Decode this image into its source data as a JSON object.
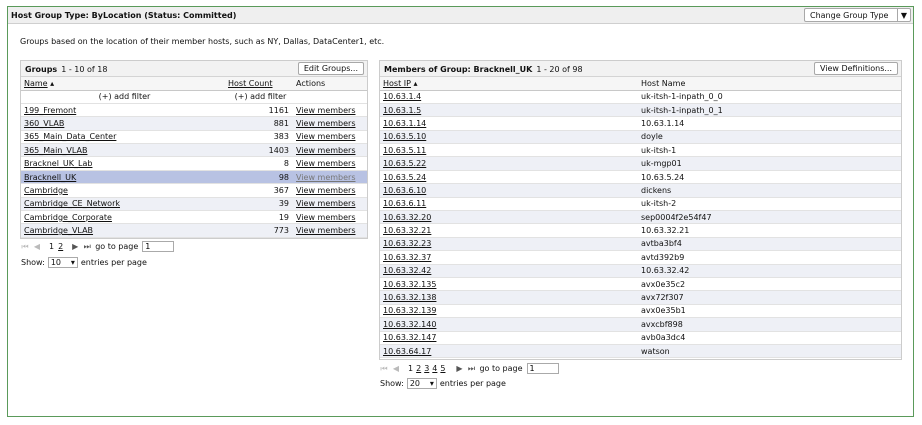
{
  "header": {
    "title": "Host Group Type: ByLocation (Status: Committed)",
    "change_button": "Change Group Type",
    "change_icon": "chevron-down-icon"
  },
  "description": "Groups based on the location of their member hosts, such as NY, Dallas, DataCenter1, etc.",
  "groups": {
    "title": "Groups",
    "range": "1 - 10 of 18",
    "edit_button": "Edit Groups...",
    "columns": {
      "name": "Name",
      "count": "Host Count",
      "actions": "Actions"
    },
    "sort_icon": "sort-up-icon",
    "filter_label": "(+) add filter",
    "rows": [
      {
        "name": "199_Fremont",
        "count": "1161",
        "action": "View members"
      },
      {
        "name": "360_VLAB",
        "count": "881",
        "action": "View members"
      },
      {
        "name": "365_Main_Data_Center",
        "count": "383",
        "action": "View members"
      },
      {
        "name": "365_Main_VLAB",
        "count": "1403",
        "action": "View members"
      },
      {
        "name": "Bracknel_UK_Lab",
        "count": "8",
        "action": "View members"
      },
      {
        "name": "Bracknell_UK",
        "count": "98",
        "action": "View members"
      },
      {
        "name": "Cambridge",
        "count": "367",
        "action": "View members"
      },
      {
        "name": "Cambridge_CE_Network",
        "count": "39",
        "action": "View members"
      },
      {
        "name": "Cambridge_Corporate",
        "count": "19",
        "action": "View members"
      },
      {
        "name": "Cambridge_VLAB",
        "count": "773",
        "action": "View members"
      }
    ],
    "selected_index": 5,
    "pager": {
      "pages": [
        "1",
        "2"
      ],
      "current": "1",
      "goto_label": "go to page",
      "goto_value": "1"
    },
    "show": {
      "label": "Show:",
      "value": "10",
      "suffix": "entries per page"
    }
  },
  "members": {
    "title": "Members of Group: Bracknell_UK",
    "range": "1 - 20 of 98",
    "defs_button": "View Definitions...",
    "columns": {
      "ip": "Host IP",
      "name": "Host Name"
    },
    "rows": [
      {
        "ip": "10.63.1.4",
        "name": "uk-itsh-1-inpath_0_0"
      },
      {
        "ip": "10.63.1.5",
        "name": "uk-itsh-1-inpath_0_1"
      },
      {
        "ip": "10.63.1.14",
        "name": "10.63.1.14"
      },
      {
        "ip": "10.63.5.10",
        "name": "doyle"
      },
      {
        "ip": "10.63.5.11",
        "name": "uk-itsh-1"
      },
      {
        "ip": "10.63.5.22",
        "name": "uk-mgp01"
      },
      {
        "ip": "10.63.5.24",
        "name": "10.63.5.24"
      },
      {
        "ip": "10.63.6.10",
        "name": "dickens"
      },
      {
        "ip": "10.63.6.11",
        "name": "uk-itsh-2"
      },
      {
        "ip": "10.63.32.20",
        "name": "sep0004f2e54f47"
      },
      {
        "ip": "10.63.32.21",
        "name": "10.63.32.21"
      },
      {
        "ip": "10.63.32.23",
        "name": "avtba3bf4"
      },
      {
        "ip": "10.63.32.37",
        "name": "avtd392b9"
      },
      {
        "ip": "10.63.32.42",
        "name": "10.63.32.42"
      },
      {
        "ip": "10.63.32.135",
        "name": "avx0e35c2"
      },
      {
        "ip": "10.63.32.138",
        "name": "avx72f307"
      },
      {
        "ip": "10.63.32.139",
        "name": "avx0e35b1"
      },
      {
        "ip": "10.63.32.140",
        "name": "avxcbf898"
      },
      {
        "ip": "10.63.32.147",
        "name": "avb0a3dc4"
      },
      {
        "ip": "10.63.64.17",
        "name": "watson"
      }
    ],
    "pager": {
      "pages": [
        "1",
        "2",
        "3",
        "4",
        "5"
      ],
      "current": "1",
      "goto_label": "go to page",
      "goto_value": "1"
    },
    "show": {
      "label": "Show:",
      "value": "20",
      "suffix": "entries per page"
    }
  },
  "colors": {
    "frame_border": "#5a9a5a",
    "selected_row": "#b8c2e3",
    "alt_row": "#eef0f6"
  }
}
